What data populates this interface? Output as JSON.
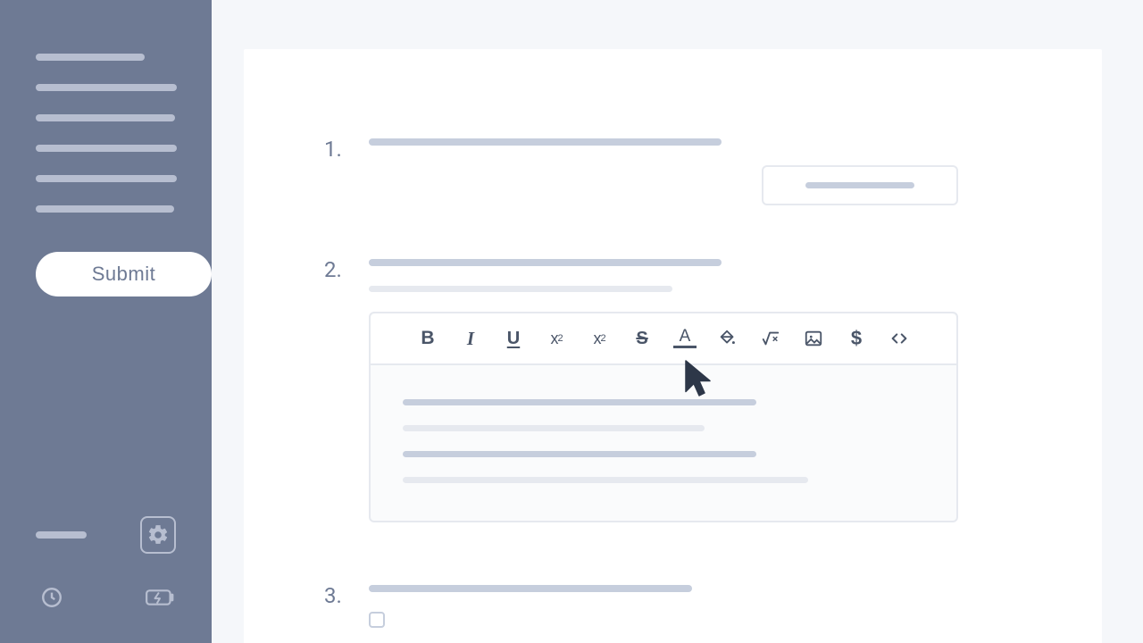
{
  "sidebar": {
    "submit_label": "Submit"
  },
  "questions": {
    "q1_num": "1.",
    "q2_num": "2.",
    "q3_num": "3."
  },
  "toolbar": {
    "bold": "B",
    "italic": "I",
    "underline": "U",
    "subscript_base": "x",
    "subscript_sub": "2",
    "superscript_base": "x",
    "superscript_sup": "2",
    "strike": "S",
    "textcolor": "A",
    "currency": "$"
  }
}
